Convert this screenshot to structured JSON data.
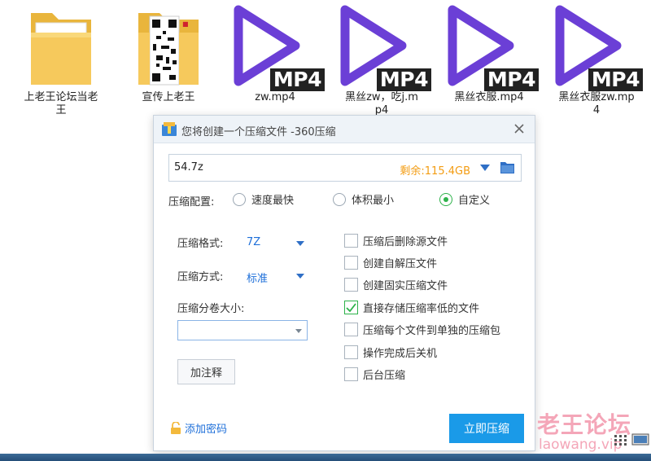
{
  "desktop": {
    "icons": [
      {
        "type": "folder",
        "label": "上老王论坛当老王"
      },
      {
        "type": "folder-qr",
        "label": "宣传上老王"
      },
      {
        "type": "mp4",
        "label": "zw.mp4",
        "badge": "MP4"
      },
      {
        "type": "mp4",
        "label": "黑丝zw，吃j.mp4",
        "badge": "MP4"
      },
      {
        "type": "mp4",
        "label": "黑丝衣服.mp4",
        "badge": "MP4"
      },
      {
        "type": "mp4",
        "label": "黑丝衣服zw.mp4",
        "badge": "MP4"
      }
    ]
  },
  "dialog": {
    "title": "您将创建一个压缩文件 -360压缩",
    "app_icon": "360-zip-icon",
    "path": {
      "value": "54.7z",
      "free_space": "剩余:115.4GB"
    },
    "preset": {
      "label": "压缩配置:",
      "options": [
        "速度最快",
        "体积最小",
        "自定义"
      ],
      "selected": "自定义"
    },
    "format": {
      "label": "压缩格式:",
      "value": "7Z"
    },
    "method": {
      "label": "压缩方式:",
      "value": "标准"
    },
    "volume": {
      "label": "压缩分卷大小:",
      "value": ""
    },
    "note_button": "加注释",
    "options": [
      {
        "label": "压缩后删除源文件",
        "checked": false
      },
      {
        "label": "创建自解压文件",
        "checked": false
      },
      {
        "label": "创建固实压缩文件",
        "checked": false
      },
      {
        "label": "直接存储压缩率低的文件",
        "checked": true
      },
      {
        "label": "压缩每个文件到单独的压缩包",
        "checked": false
      },
      {
        "label": "操作完成后关机",
        "checked": false
      },
      {
        "label": "后台压缩",
        "checked": false
      }
    ],
    "password_link": "添加密码",
    "start_button": "立即压缩"
  },
  "watermark": {
    "text": "老王论坛",
    "url": "laowang.vip"
  },
  "colors": {
    "accent": "#1a9ae8",
    "folder": "#f6c95c",
    "play": "#6b3fd6",
    "free_space": "#f39c12",
    "check": "#2db24a"
  }
}
